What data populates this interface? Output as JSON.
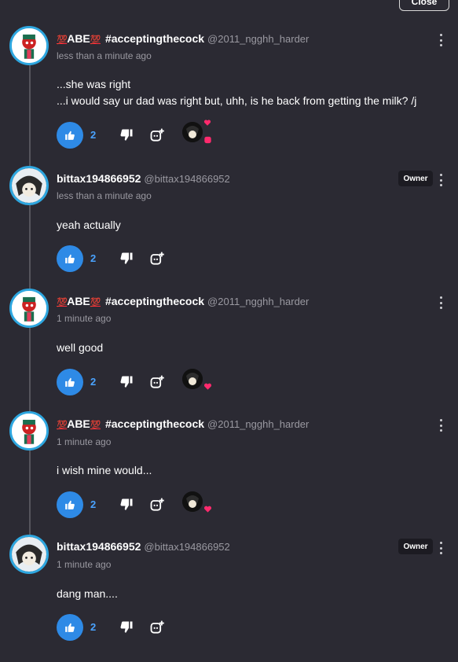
{
  "top_button": {
    "label": "Close"
  },
  "comments": [
    {
      "author_prefix": "💯",
      "author": "ABE",
      "author_suffix": "💯",
      "author_tag": "#acceptingthecock",
      "handle": "@2011_ngghh_harder",
      "timestamp": "less than a minute ago",
      "lines": [
        "...she was right",
        "...i would say ur dad was right but, uhh, is he back from getting the milk? /j"
      ],
      "likes": "2",
      "owner_badge": "",
      "creator_heart": true
    },
    {
      "author": "bittax194866952",
      "handle": "@bittax194866952",
      "timestamp": "less than a minute ago",
      "lines": [
        "yeah actually"
      ],
      "likes": "2",
      "owner_badge": "Owner",
      "creator_heart": false
    },
    {
      "author_prefix": "💯",
      "author": "ABE",
      "author_suffix": "💯",
      "author_tag": "#acceptingthecock",
      "handle": "@2011_ngghh_harder",
      "timestamp": "1 minute ago",
      "lines": [
        "well good"
      ],
      "likes": "2",
      "owner_badge": "",
      "creator_heart": true
    },
    {
      "author_prefix": "💯",
      "author": "ABE",
      "author_suffix": "💯",
      "author_tag": "#acceptingthecock",
      "handle": "@2011_ngghh_harder",
      "timestamp": "1 minute ago",
      "lines": [
        "i wish mine would..."
      ],
      "likes": "2",
      "owner_badge": "",
      "creator_heart": true
    },
    {
      "author": "bittax194866952",
      "handle": "@bittax194866952",
      "timestamp": "1 minute ago",
      "lines": [
        "dang man...."
      ],
      "likes": "2",
      "owner_badge": "Owner",
      "creator_heart": false
    }
  ],
  "icons": {
    "like": "thumbs-up-icon",
    "dislike": "thumbs-down-icon",
    "reply": "reply-icon",
    "more": "kebab-menu-icon",
    "heart": "heart-icon"
  },
  "colors": {
    "background": "#2b2a33",
    "accent": "#2e8ae6",
    "like_count": "#4aa3ff",
    "heart": "#ff2a6d",
    "avatar_ring": "#2ea7e0",
    "muted_text": "#9a99a1"
  }
}
